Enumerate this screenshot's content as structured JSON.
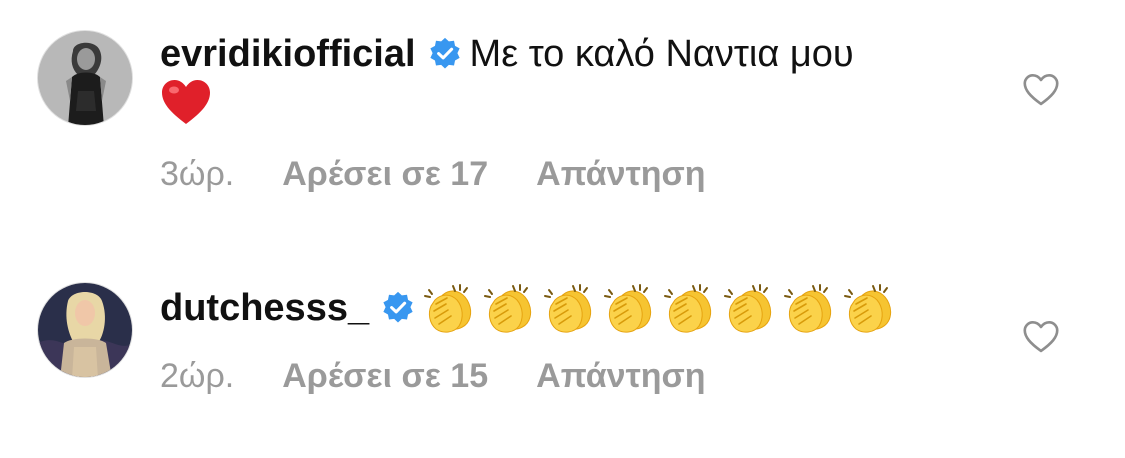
{
  "comments": [
    {
      "username": "evridikiofficial",
      "verified": true,
      "text": "Με το καλό Ναντια μου",
      "emoji": "heart",
      "time": "3ώρ.",
      "likes_label": "Αρέσει σε 17",
      "reply_label": "Απάντηση"
    },
    {
      "username": "dutchesss_",
      "verified": true,
      "text": "",
      "emoji": "clapping-hands",
      "emoji_count": 8,
      "time": "2ώρ.",
      "likes_label": "Αρέσει σε 15",
      "reply_label": "Απάντηση"
    }
  ],
  "colors": {
    "verified_badge": "#3897f0",
    "meta_text": "#9a9a9a",
    "heart_outline": "#8e8e8e",
    "heart_emoji": "#e0202a",
    "clap_emoji": "#f6c431"
  }
}
